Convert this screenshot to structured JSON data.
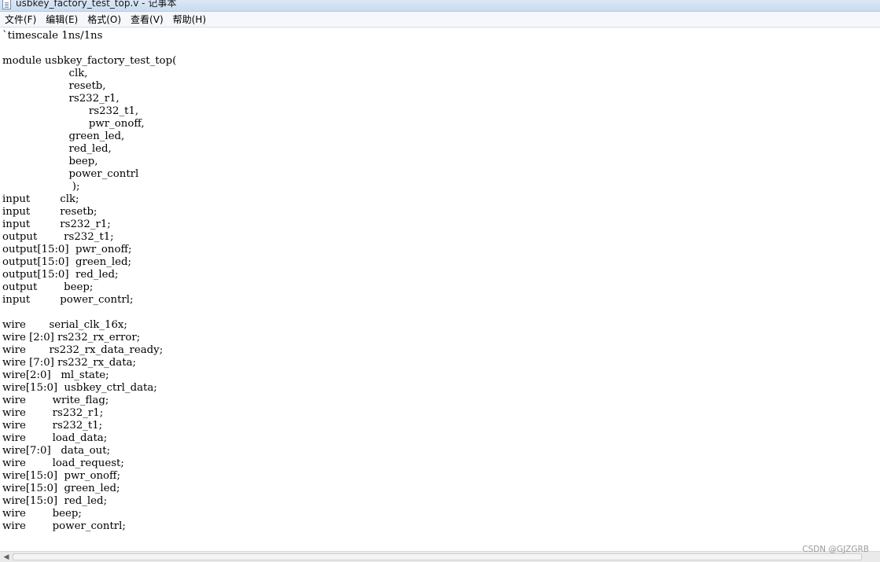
{
  "window": {
    "title": "usbkey_factory_test_top.v - 记事本"
  },
  "menu": {
    "items": [
      {
        "label": "文件(F)"
      },
      {
        "label": "编辑(E)"
      },
      {
        "label": "格式(O)"
      },
      {
        "label": "查看(V)"
      },
      {
        "label": "帮助(H)"
      }
    ]
  },
  "editor": {
    "lines": [
      "`timescale 1ns/1ns",
      "",
      "module usbkey_factory_test_top(",
      "                    clk,",
      "                    resetb,",
      "                    rs232_r1,",
      "                          rs232_t1,",
      "                          pwr_onoff,",
      "                    green_led,",
      "                    red_led,",
      "                    beep,",
      "                    power_contrl",
      "                     );",
      "input         clk;",
      "input         resetb;",
      "input         rs232_r1;",
      "output        rs232_t1;",
      "output[15:0]  pwr_onoff;",
      "output[15:0]  green_led;",
      "output[15:0]  red_led;",
      "output        beep;",
      "input         power_contrl;",
      "",
      "wire       serial_clk_16x;",
      "wire [2:0] rs232_rx_error;",
      "wire       rs232_rx_data_ready;",
      "wire [7:0] rs232_rx_data;",
      "wire[2:0]   ml_state;",
      "wire[15:0]  usbkey_ctrl_data;",
      "wire        write_flag;",
      "wire        rs232_r1;",
      "wire        rs232_t1;",
      "wire        load_data;",
      "wire[7:0]   data_out;",
      "wire        load_request;",
      "wire[15:0]  pwr_onoff;",
      "wire[15:0]  green_led;",
      "wire[15:0]  red_led;",
      "wire        beep;",
      "wire        power_contrl;"
    ]
  },
  "watermark": "CSDN @GJZGRB",
  "scrollbar": {
    "left_arrow_icon": "arrow-left-icon"
  }
}
